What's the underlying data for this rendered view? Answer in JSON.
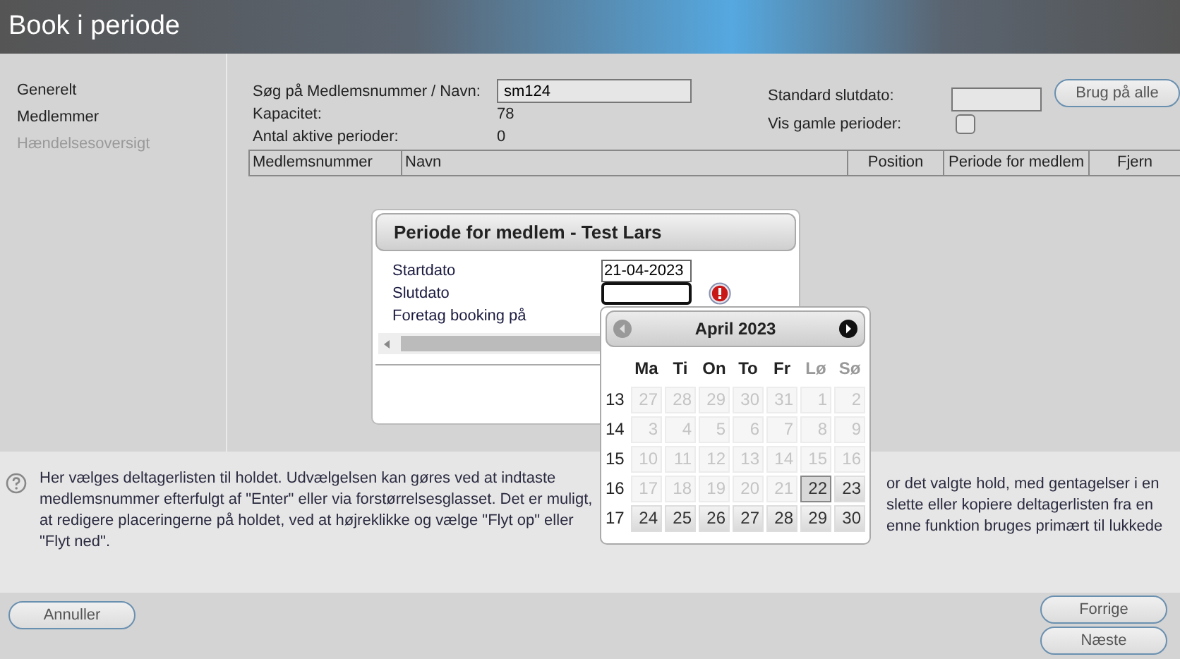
{
  "window": {
    "title": "Book i periode"
  },
  "sidebar": {
    "items": [
      {
        "label": "Generelt",
        "disabled": false
      },
      {
        "label": "Medlemmer",
        "disabled": false
      },
      {
        "label": "Hændelsesoversigt",
        "disabled": true
      }
    ]
  },
  "search": {
    "label": "Søg på Medlemsnummer / Navn:",
    "value": "sm124"
  },
  "stats": [
    {
      "label": "Kapacitet:",
      "value": "78"
    },
    {
      "label": "Antal aktive perioder:",
      "value": "0"
    }
  ],
  "default_end": {
    "label": "Standard slutdato:",
    "button": "Brug på alle"
  },
  "show_old": {
    "label": "Vis gamle perioder:",
    "checked": false
  },
  "table": {
    "columns": [
      "Medlemsnummer",
      "Navn",
      "Position",
      "Periode for medlem",
      "Fjern"
    ]
  },
  "dialog": {
    "title": "Periode for medlem - Test Lars",
    "fields": [
      {
        "label": "Startdato",
        "value": "21-04-2023",
        "error": false,
        "focused": false
      },
      {
        "label": "Slutdato",
        "error": true,
        "focused": true
      }
    ],
    "booking_label": "Foretag booking på"
  },
  "calendar": {
    "title": "April 2023",
    "prev_disabled": true,
    "next_disabled": false,
    "weekdays": [
      {
        "label": "Ma",
        "weekend": false
      },
      {
        "label": "Ti",
        "weekend": false
      },
      {
        "label": "On",
        "weekend": false
      },
      {
        "label": "To",
        "weekend": false
      },
      {
        "label": "Fr",
        "weekend": false
      },
      {
        "label": "Lø",
        "weekend": true
      },
      {
        "label": "Sø",
        "weekend": true
      }
    ],
    "weeks": [
      {
        "number": "13",
        "days": [
          {
            "day": "27",
            "disabled": true,
            "selected": false
          },
          {
            "day": "28",
            "disabled": true,
            "selected": false
          },
          {
            "day": "29",
            "disabled": true,
            "selected": false
          },
          {
            "day": "30",
            "disabled": true,
            "selected": false
          },
          {
            "day": "31",
            "disabled": true,
            "selected": false
          },
          {
            "day": "1",
            "disabled": true,
            "selected": false
          },
          {
            "day": "2",
            "disabled": true,
            "selected": false
          }
        ]
      },
      {
        "number": "14",
        "days": [
          {
            "day": "3",
            "disabled": true,
            "selected": false
          },
          {
            "day": "4",
            "disabled": true,
            "selected": false
          },
          {
            "day": "5",
            "disabled": true,
            "selected": false
          },
          {
            "day": "6",
            "disabled": true,
            "selected": false
          },
          {
            "day": "7",
            "disabled": true,
            "selected": false
          },
          {
            "day": "8",
            "disabled": true,
            "selected": false
          },
          {
            "day": "9",
            "disabled": true,
            "selected": false
          }
        ]
      },
      {
        "number": "15",
        "days": [
          {
            "day": "10",
            "disabled": true,
            "selected": false
          },
          {
            "day": "11",
            "disabled": true,
            "selected": false
          },
          {
            "day": "12",
            "disabled": true,
            "selected": false
          },
          {
            "day": "13",
            "disabled": true,
            "selected": false
          },
          {
            "day": "14",
            "disabled": true,
            "selected": false
          },
          {
            "day": "15",
            "disabled": true,
            "selected": false
          },
          {
            "day": "16",
            "disabled": true,
            "selected": false
          }
        ]
      },
      {
        "number": "16",
        "days": [
          {
            "day": "17",
            "disabled": true,
            "selected": false
          },
          {
            "day": "18",
            "disabled": true,
            "selected": false
          },
          {
            "day": "19",
            "disabled": true,
            "selected": false
          },
          {
            "day": "20",
            "disabled": true,
            "selected": false
          },
          {
            "day": "21",
            "disabled": true,
            "selected": false
          },
          {
            "day": "22",
            "disabled": false,
            "selected": true
          },
          {
            "day": "23",
            "disabled": false,
            "selected": false
          }
        ]
      },
      {
        "number": "17",
        "days": [
          {
            "day": "24",
            "disabled": false,
            "selected": false
          },
          {
            "day": "25",
            "disabled": false,
            "selected": false
          },
          {
            "day": "26",
            "disabled": false,
            "selected": false
          },
          {
            "day": "27",
            "disabled": false,
            "selected": false
          },
          {
            "day": "28",
            "disabled": false,
            "selected": false
          },
          {
            "day": "29",
            "disabled": false,
            "selected": false
          },
          {
            "day": "30",
            "disabled": false,
            "selected": false
          }
        ]
      }
    ]
  },
  "help": {
    "text": "Her vælges deltagerlisten til holdet. Udvælgelsen kan gøres ved at indtaste medlemsnummer efterfulgt af \"Enter\" eller via forstørrelsesglasset. Det er muligt, at redigere placeringerne på holdet, ved at højreklikke og vælge \"Flyt op\" eller \"Flyt ned\".",
    "text_2_lines": [
      "or det valgte hold, med gentagelser i en",
      "slette eller kopiere deltagerlisten fra en",
      "enne funktion bruges primært til lukkede"
    ]
  },
  "footer": {
    "cancel": "Annuller",
    "prev": "Forrige",
    "next": "Næste"
  }
}
